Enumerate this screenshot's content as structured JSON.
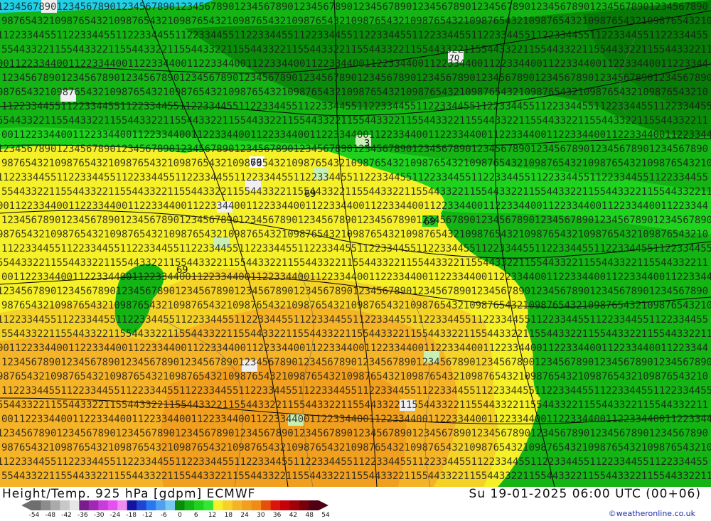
{
  "map": {
    "colors": {
      "green_dark": "#0a8c0a",
      "green": "#14b414",
      "green_light": "#1ed21e",
      "yellow": "#f5f028",
      "yellow_orange": "#f5d228",
      "orange": "#f5b428",
      "dark_orange": "#f0a01e",
      "cyan": "#22d0e6"
    },
    "labels": [
      {
        "text": "69"
      },
      {
        "text": "69"
      },
      {
        "text": "69"
      },
      {
        "text": "69"
      },
      {
        "text": "3"
      },
      {
        "text": "70"
      }
    ]
  },
  "footer": {
    "title_left": "Height/Temp. 925 hPa [gdpm] ECMWF",
    "title_right": "Su 19-01-2025 06:00 UTC (00+06)",
    "credit": "©weatheronline.co.uk",
    "legend": {
      "ticks": [
        "-54",
        "-48",
        "-42",
        "-36",
        "-30",
        "-24",
        "-18",
        "-12",
        "-6",
        "0",
        "6",
        "12",
        "18",
        "24",
        "30",
        "36",
        "42",
        "48",
        "54"
      ],
      "colors": [
        "#6e6e6e",
        "#8c8c8c",
        "#aaaaaa",
        "#c8c8c8",
        "#e6e6e6",
        "#781e8c",
        "#a028b4",
        "#c83cdc",
        "#e650f0",
        "#f08cf0",
        "#1414a0",
        "#1e46d2",
        "#2878f0",
        "#50a0f0",
        "#78c8f0",
        "#0a8c0a",
        "#14b414",
        "#1ed21e",
        "#32e632",
        "#f5f028",
        "#f5d228",
        "#f5b428",
        "#f0a01e",
        "#f08c14",
        "#e6500a",
        "#dc140a",
        "#c8000a",
        "#a0000a",
        "#78000a",
        "#500014"
      ]
    }
  }
}
